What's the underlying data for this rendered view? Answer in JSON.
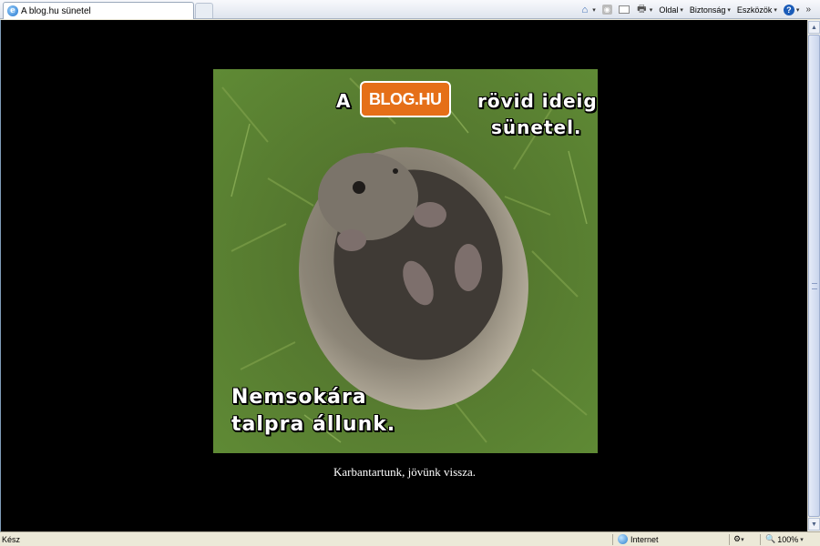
{
  "browser": {
    "tab_title": "A blog.hu sünetel",
    "commands": {
      "page_label": "Oldal",
      "safety_label": "Biztonság",
      "tools_label": "Eszközök"
    }
  },
  "page": {
    "image_text": {
      "line1_prefix": "A",
      "logo": "BLOG.HU",
      "line1_suffix": "rövid ideig",
      "line2": "sünetel.",
      "bottom_line1": "Nemsokára",
      "bottom_line2": "talpra állunk."
    },
    "caption": "Karbantartunk, jövünk vissza."
  },
  "status": {
    "text": "Kész",
    "zone": "Internet",
    "zoom": "100%"
  },
  "colors": {
    "page_background": "#000000",
    "logo_orange": "#e56f18"
  }
}
